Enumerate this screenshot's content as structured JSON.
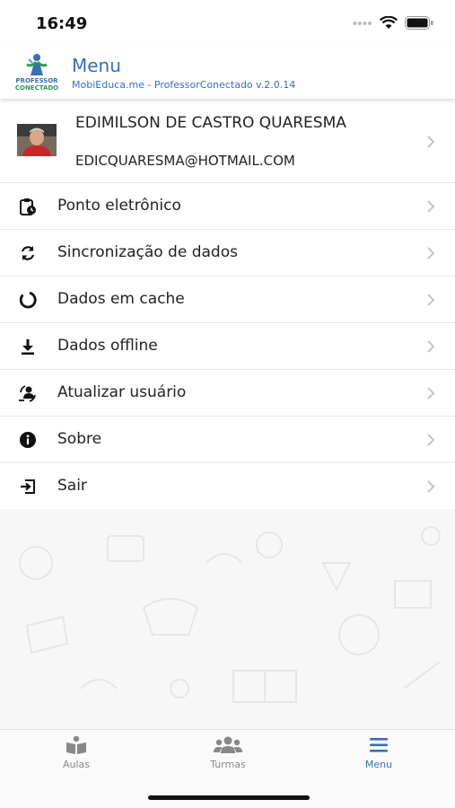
{
  "status": {
    "time": "16:49"
  },
  "header": {
    "logo_line1": "PROFESSOR",
    "logo_line2": "CONECTADO",
    "title": "Menu",
    "subtitle": "MobiEduca.me - ProfessorConectado v.2.0.14"
  },
  "profile": {
    "name": "EDIMILSON DE CASTRO QUARESMA",
    "email": "EDICQUARESMA@HOTMAIL.COM"
  },
  "menu": {
    "items": [
      {
        "label": "Ponto eletrônico",
        "icon": "clipboard-clock-icon"
      },
      {
        "label": "Sincronização de dados",
        "icon": "sync-icon"
      },
      {
        "label": "Dados em cache",
        "icon": "circle-notch-icon"
      },
      {
        "label": "Dados offline",
        "icon": "download-icon"
      },
      {
        "label": "Atualizar usuário",
        "icon": "user-refresh-icon"
      },
      {
        "label": "Sobre",
        "icon": "info-icon"
      },
      {
        "label": "Sair",
        "icon": "sign-out-icon"
      }
    ]
  },
  "tabs": [
    {
      "label": "Aulas",
      "icon": "book-icon",
      "active": false
    },
    {
      "label": "Turmas",
      "icon": "users-icon",
      "active": false
    },
    {
      "label": "Menu",
      "icon": "menu-icon",
      "active": true
    }
  ],
  "colors": {
    "accent": "#3a6fb0",
    "logo_green": "#2f9a5a",
    "inactive_tab": "#888888"
  }
}
